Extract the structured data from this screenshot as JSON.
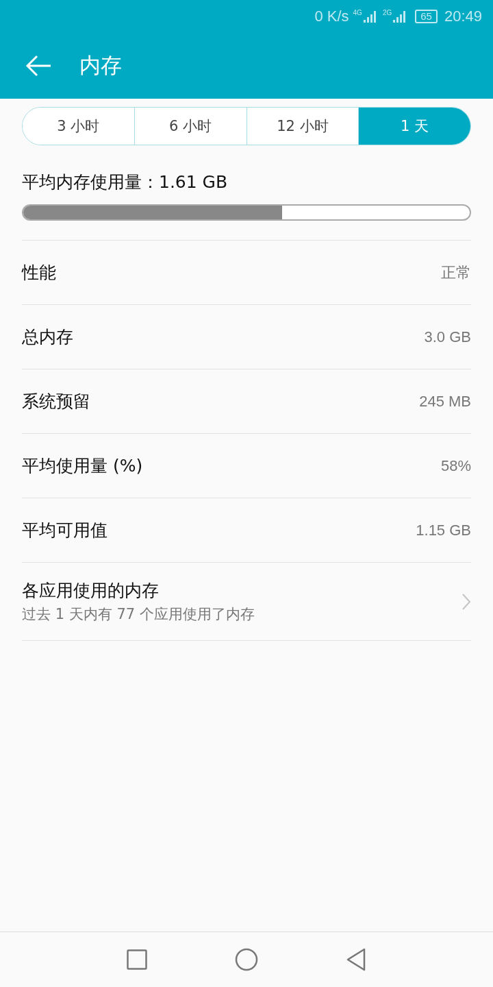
{
  "status_bar": {
    "speed": "0 K/s",
    "network_1": "4G",
    "network_2": "2G",
    "battery": "65",
    "time": "20:49"
  },
  "app_bar": {
    "title": "内存"
  },
  "tabs": [
    {
      "label": "3 小时",
      "selected": false
    },
    {
      "label": "6 小时",
      "selected": false
    },
    {
      "label": "12 小时",
      "selected": false
    },
    {
      "label": "1 天",
      "selected": true
    }
  ],
  "average": {
    "label": "平均内存使用量：1.61 GB",
    "level": 0.58
  },
  "rows": [
    {
      "label": "性能",
      "value": "正常"
    },
    {
      "label": "总内存",
      "value": "3.0 GB"
    },
    {
      "label": "系统预留",
      "value": "245 MB"
    },
    {
      "label": "平均使用量 (%)",
      "value": "58%"
    },
    {
      "label": "平均可用值",
      "value": "1.15 GB"
    }
  ],
  "app_usage": {
    "title": "各应用使用的内存",
    "subtitle": "过去 1 天内有 77 个应用使用了内存"
  }
}
